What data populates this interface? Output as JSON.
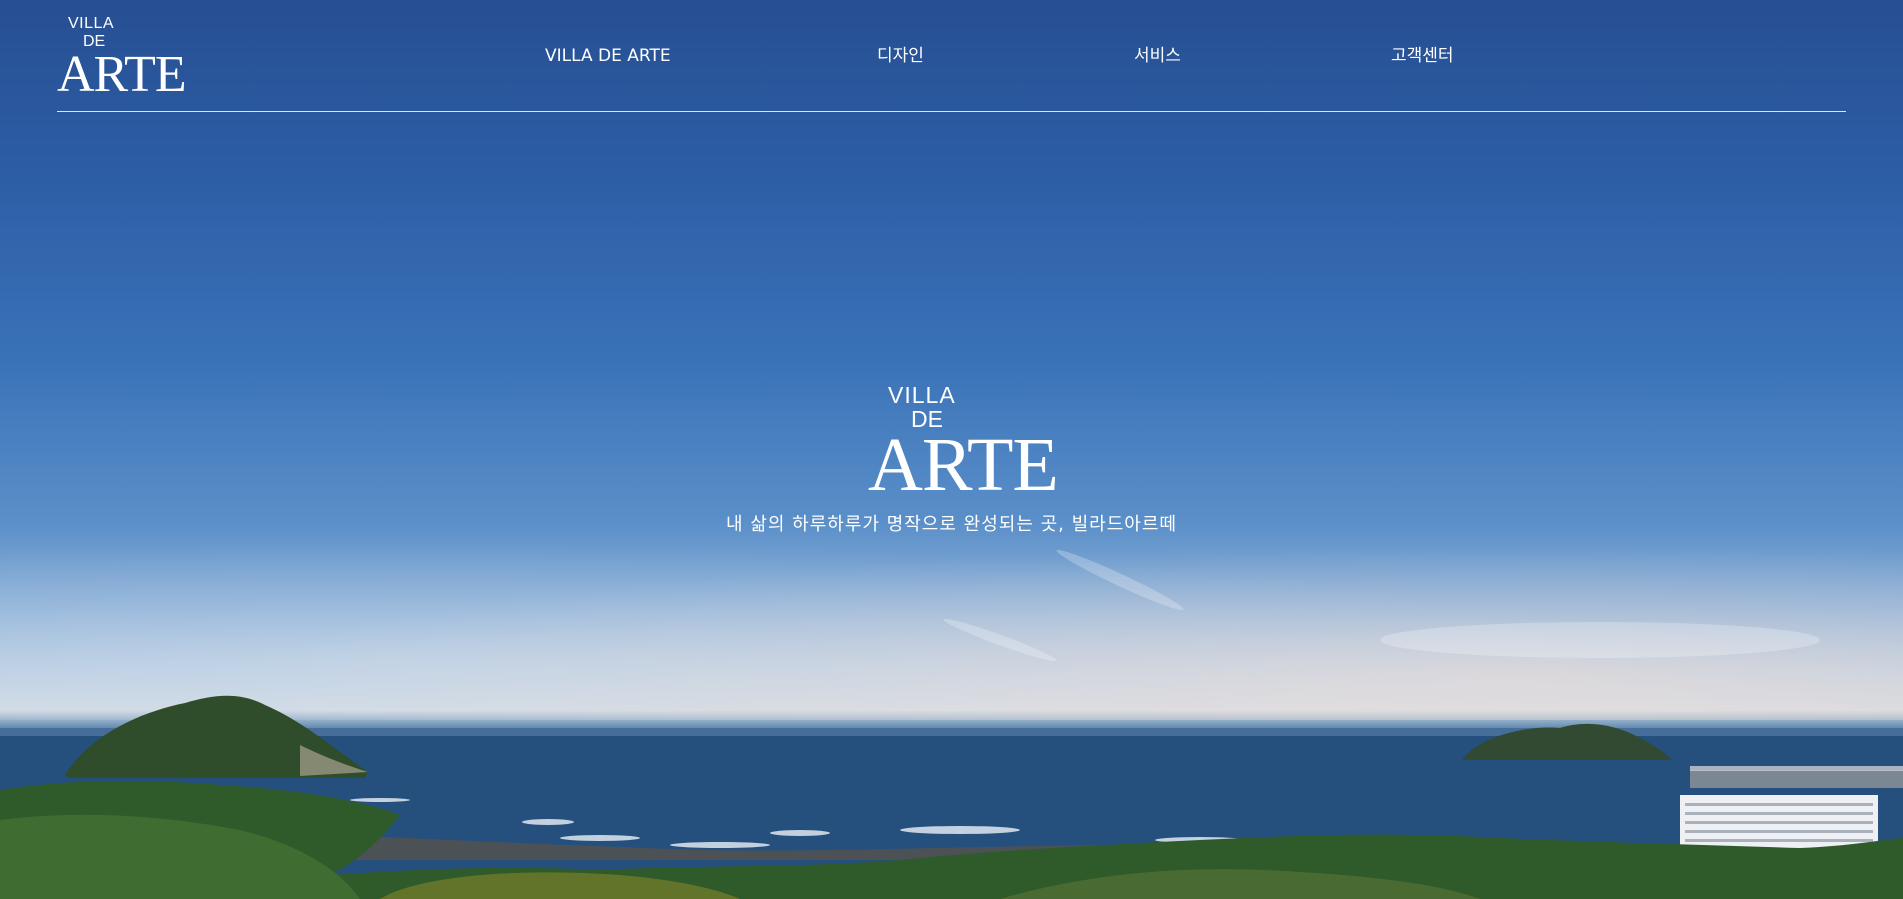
{
  "header": {
    "logo": {
      "line1": "VILLA",
      "line2": "DE",
      "line3": "ARTE"
    },
    "nav": [
      {
        "label": "VILLA DE ARTE"
      },
      {
        "label": "디자인"
      },
      {
        "label": "서비스"
      },
      {
        "label": "고객센터"
      }
    ]
  },
  "hero": {
    "logo": {
      "line1": "VILLA",
      "line2": "DE",
      "line3": "ARTE"
    },
    "tagline": "내 삶의 하루하루가 명작으로 완성되는 곳, 빌라드아르떼"
  },
  "colors": {
    "sky_top": "#274f92",
    "sky_horizon": "#cfd9e3",
    "sea": "#244c75",
    "foliage": "#2f5a2a",
    "text": "#ffffff"
  }
}
